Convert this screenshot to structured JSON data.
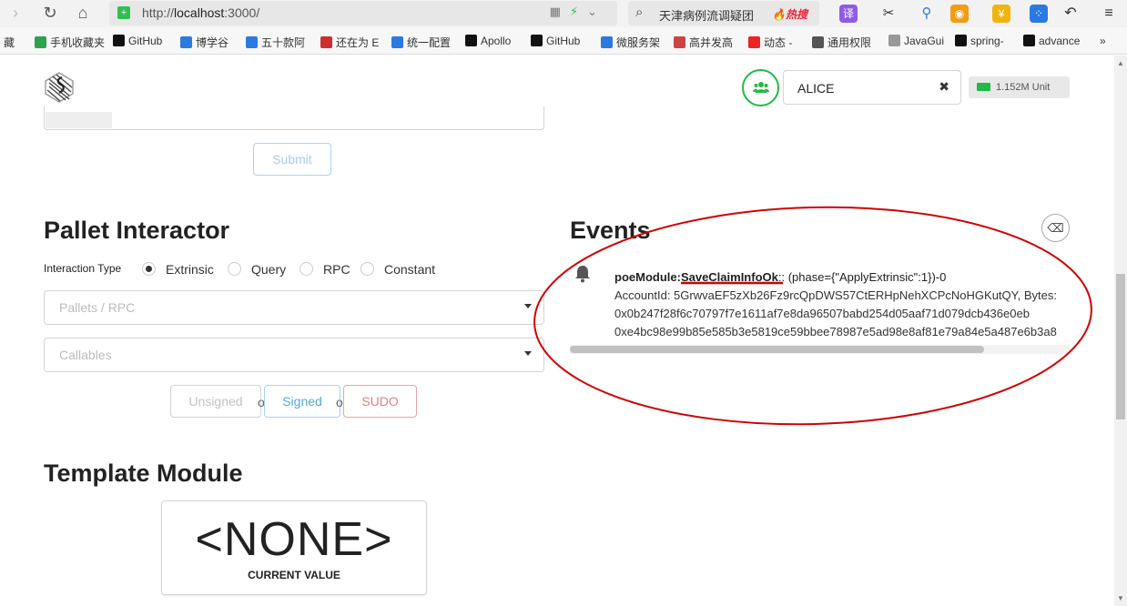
{
  "browser": {
    "url_prefix": "http://",
    "url_host": "localhost",
    "url_rest": ":3000/",
    "search_query": "天津病例流调疑团",
    "search_hot": "🔥热搜",
    "bookmarks": [
      {
        "label": "藏",
        "color": "#666"
      },
      {
        "label": "手机收藏夹",
        "color": "#2ca24b"
      },
      {
        "label": "GitHub",
        "color": "#111"
      },
      {
        "label": "博学谷",
        "color": "#2a7ae2"
      },
      {
        "label": "五十款阿",
        "color": "#2a7ae2"
      },
      {
        "label": "还在为 E",
        "color": "#d12d2d"
      },
      {
        "label": "统一配置",
        "color": "#2a7ae2"
      },
      {
        "label": "Apollo",
        "color": "#111"
      },
      {
        "label": "GitHub",
        "color": "#111"
      },
      {
        "label": "微服务架",
        "color": "#2a7ae2"
      },
      {
        "label": "高并发高",
        "color": "#c44"
      },
      {
        "label": "动态 -",
        "color": "#e22"
      },
      {
        "label": "通用权限",
        "color": "#555"
      },
      {
        "label": "JavaGui",
        "color": "#999"
      },
      {
        "label": "spring-",
        "color": "#111"
      },
      {
        "label": "advance",
        "color": "#111"
      }
    ],
    "more_label": "»"
  },
  "header": {
    "account_name": "ALICE",
    "clear_symbol": "✖",
    "balance": "1.152M Unit"
  },
  "submit_label": "Submit",
  "pallet": {
    "title": "Pallet Interactor",
    "interaction_label": "Interaction Type",
    "options": [
      "Extrinsic",
      "Query",
      "RPC",
      "Constant"
    ],
    "selected": "Extrinsic",
    "pallets_placeholder": "Pallets / RPC",
    "callables_placeholder": "Callables",
    "unsigned_label": "Unsigned",
    "or_label": "or",
    "signed_label": "Signed",
    "sudo_label": "SUDO"
  },
  "template": {
    "title": "Template Module",
    "value": "<NONE>",
    "caption": "CURRENT VALUE"
  },
  "events": {
    "title": "Events",
    "items": [
      {
        "module": "poeModule:",
        "event": "SaveClaimInfoOk",
        "suffix": ":: (phase={\"ApplyExtrinsic\":1})-0",
        "lines": [
          "AccountId: 5GrwvaEF5zXb26Fz9rcQpDWS57CtERHpNehXCPcNoHGKutQY, Bytes:",
          "0x0b247f28f6c70797f7e1611af7e8da96507babd254d05aaf71d079dcb436e0eb",
          "0xe4bc98e99b85e585b3e5819ce59bbee78987e5ad98e8af81e79a84e5a487e6b3a8"
        ]
      }
    ]
  },
  "colors": {
    "accent_green": "#21ba45",
    "signed_blue": "#54a6d8",
    "sudo_red": "#db6a6a",
    "annotation_red": "#d10000"
  }
}
